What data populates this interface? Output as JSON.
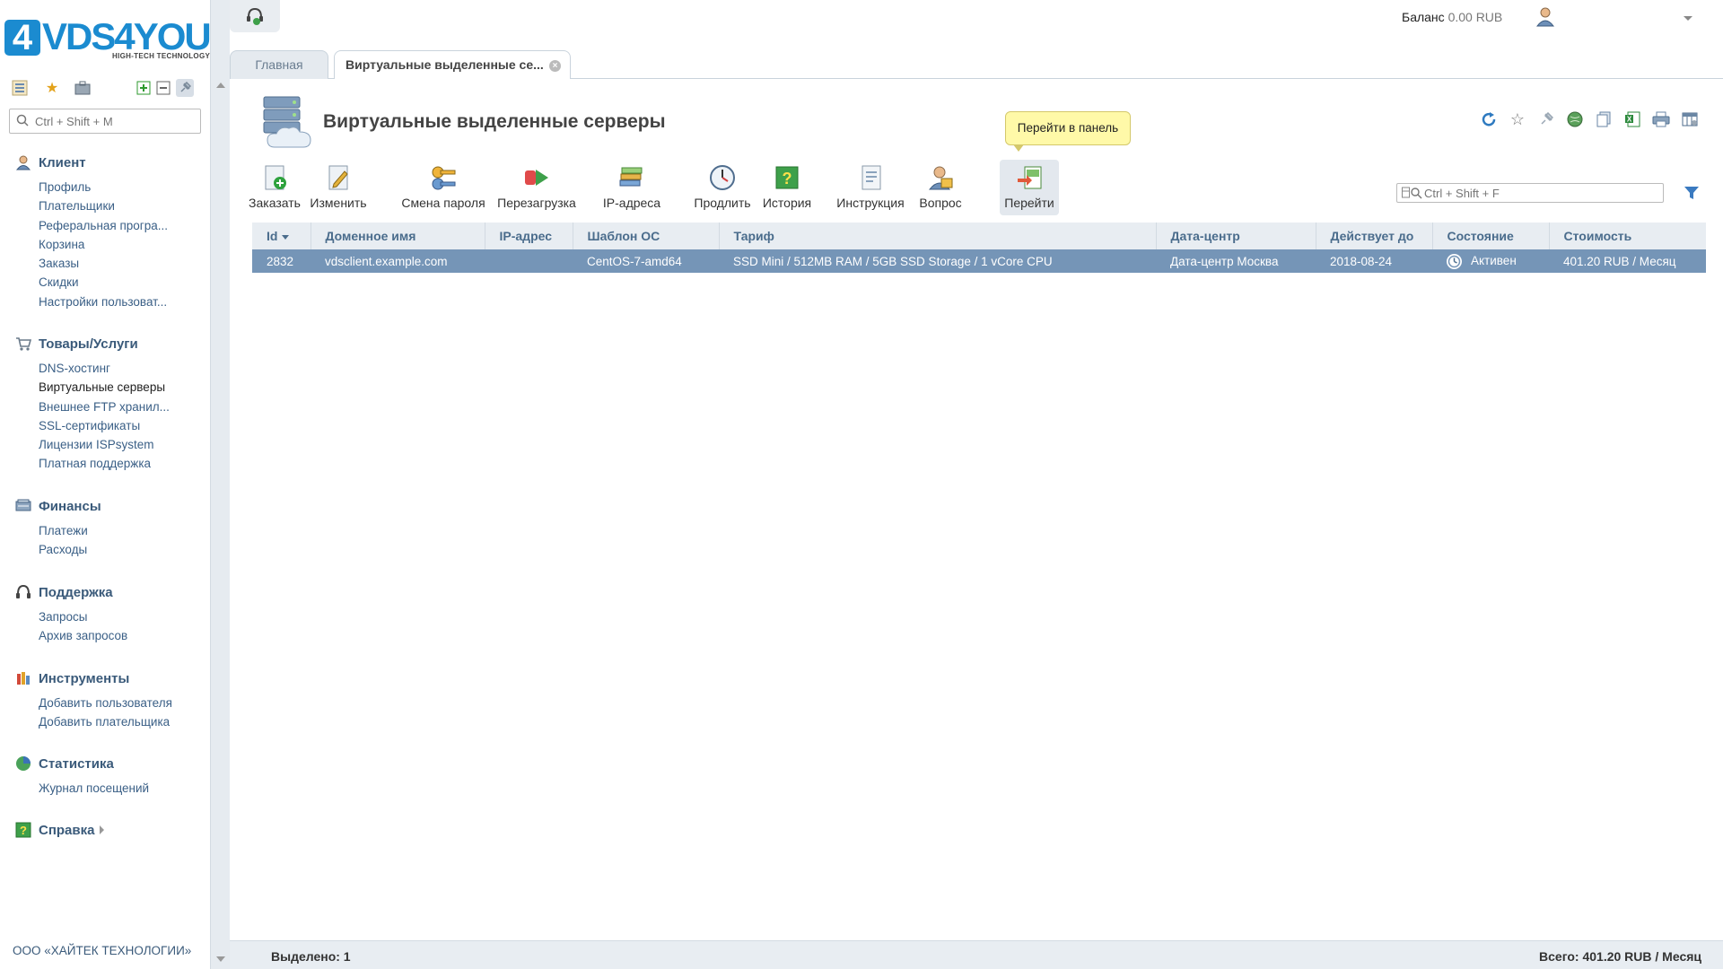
{
  "brand": {
    "four": "4",
    "name": "VDS4YOU",
    "tagline": "HIGH-TECH TECHNOLOGY"
  },
  "sidebar": {
    "search_placeholder": "Ctrl + Shift + M",
    "groups": [
      {
        "title": "Клиент",
        "icon": "client-icon",
        "items": [
          "Профиль",
          "Плательщики",
          "Реферальная програ...",
          "Корзина",
          "Заказы",
          "Скидки",
          "Настройки пользоват..."
        ]
      },
      {
        "title": "Товары/Услуги",
        "icon": "cart-icon",
        "items": [
          "DNS-хостинг",
          "Виртуальные серверы",
          "Внешнее FTP хранил...",
          "SSL-сертификаты",
          "Лицензии ISPsystem",
          "Платная поддержка"
        ],
        "active": 1
      },
      {
        "title": "Финансы",
        "icon": "finance-icon",
        "items": [
          "Платежи",
          "Расходы"
        ]
      },
      {
        "title": "Поддержка",
        "icon": "headset-icon",
        "items": [
          "Запросы",
          "Архив запросов"
        ]
      },
      {
        "title": "Инструменты",
        "icon": "tools-icon",
        "items": [
          "Добавить пользователя",
          "Добавить плательщика"
        ]
      },
      {
        "title": "Статистика",
        "icon": "stats-icon",
        "items": [
          "Журнал посещений"
        ]
      },
      {
        "title": "Справка",
        "icon": "help-icon",
        "items": []
      }
    ],
    "footer": "ООО «ХАЙТЕК ТЕХНОЛОГИИ»"
  },
  "header": {
    "balance_label": "Баланс",
    "balance_value": "0.00 RUB"
  },
  "tabs": [
    {
      "label": "Главная"
    },
    {
      "label": "Виртуальные выделенные се..."
    }
  ],
  "page": {
    "title": "Виртуальные выделенные серверы"
  },
  "tooltip": "Перейти в панель",
  "toolbar": [
    {
      "label": "Заказать",
      "icon": "order-icon"
    },
    {
      "label": "Изменить",
      "icon": "edit-icon"
    },
    {
      "label": "Смена пароля",
      "icon": "password-icon"
    },
    {
      "label": "Перезагрузка",
      "icon": "reboot-icon"
    },
    {
      "label": "IP-адреса",
      "icon": "ip-icon"
    },
    {
      "label": "Продлить",
      "icon": "prolong-icon"
    },
    {
      "label": "История",
      "icon": "history-icon"
    },
    {
      "label": "Инструкция",
      "icon": "instruction-icon"
    },
    {
      "label": "Вопрос",
      "icon": "question-icon"
    },
    {
      "label": "Перейти",
      "icon": "goto-icon"
    }
  ],
  "filter_placeholder": "Ctrl + Shift + F",
  "table": {
    "columns": [
      "Id",
      "Доменное имя",
      "IP-адрес",
      "Шаблон ОС",
      "Тариф",
      "Дата-центр",
      "Действует до",
      "Состояние",
      "Стоимость"
    ],
    "rows": [
      {
        "id": "2832",
        "domain": "vdsclient.example.com",
        "ip": "",
        "os": "CentOS-7-amd64",
        "tariff": "SSD Mini / 512MB RAM / 5GB SSD Storage / 1 vCore CPU",
        "dc": "Дата-центр Москва",
        "expires": "2018-08-24",
        "status": "Активен",
        "cost": "401.20 RUB / Месяц"
      }
    ]
  },
  "statusbar": {
    "selected": "Выделено: 1",
    "total": "Всего: 401.20 RUB / Месяц"
  },
  "colors": {
    "accent": "#1b8bd0",
    "selected_row": "#7595b7",
    "tooltip": "#fff9a8",
    "header_bg": "#e8edf2"
  }
}
